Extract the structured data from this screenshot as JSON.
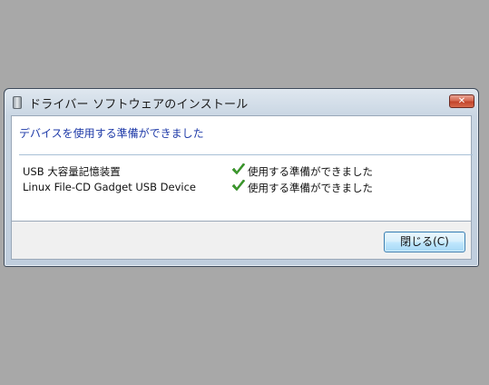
{
  "window": {
    "title": "ドライバー ソフトウェアのインストール",
    "close_glyph": "✕"
  },
  "content": {
    "heading": "デバイスを使用する準備ができました",
    "devices": [
      {
        "name": "USB 大容量記憶装置",
        "status": "使用する準備ができました",
        "icon": "check-icon"
      },
      {
        "name": "Linux File-CD Gadget USB Device",
        "status": "使用する準備ができました",
        "icon": "check-icon"
      }
    ]
  },
  "footer": {
    "close_button_label": "閉じる(C)"
  },
  "colors": {
    "heading": "#1e3aa8",
    "check": "#3a9a2a",
    "desktop": "#a8a8a8"
  }
}
